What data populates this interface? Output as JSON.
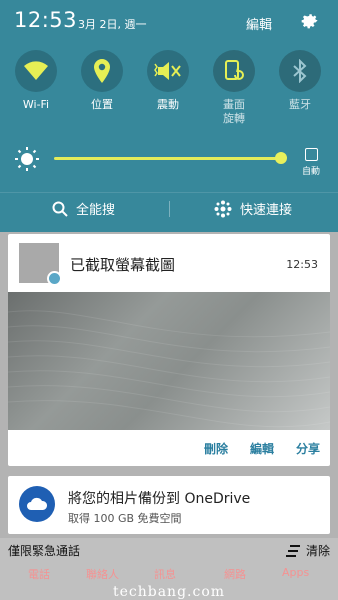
{
  "status": {
    "time": "12:53",
    "date": "3月 2日, 週一",
    "edit_label": "編輯"
  },
  "quick_settings": [
    {
      "label": "Wi-Fi",
      "icon": "wifi-icon"
    },
    {
      "label": "位置",
      "icon": "location-icon"
    },
    {
      "label": "震動",
      "icon": "vibrate-icon"
    },
    {
      "label": "畫面\n旋轉",
      "line1": "畫面",
      "line2": "旋轉",
      "icon": "rotate-icon"
    },
    {
      "label": "藍牙",
      "icon": "bluetooth-icon"
    }
  ],
  "brightness": {
    "level": 0.98,
    "auto_label": "自動"
  },
  "search": {
    "search_label": "全能搜",
    "quick_connect_label": "快速連接"
  },
  "screenshot_notification": {
    "title": "已截取螢幕截圖",
    "time": "12:53",
    "actions": [
      "刪除",
      "編輯",
      "分享"
    ]
  },
  "onedrive_notification": {
    "title": "將您的相片備份到 OneDrive",
    "subtitle": "取得 100 GB 免費空間"
  },
  "bottom": {
    "emergency_label": "僅限緊急通話",
    "clear_label": "清除",
    "dock_labels": [
      "電話",
      "聯絡人",
      "訊息",
      "網路",
      "Apps"
    ],
    "watermark": "techbang.com"
  },
  "colors": {
    "panel_bg": "#37889b",
    "accent_yellow": "#e4ec5a",
    "action_blue": "#2b7fa0",
    "onedrive_blue": "#1f5fb3"
  }
}
